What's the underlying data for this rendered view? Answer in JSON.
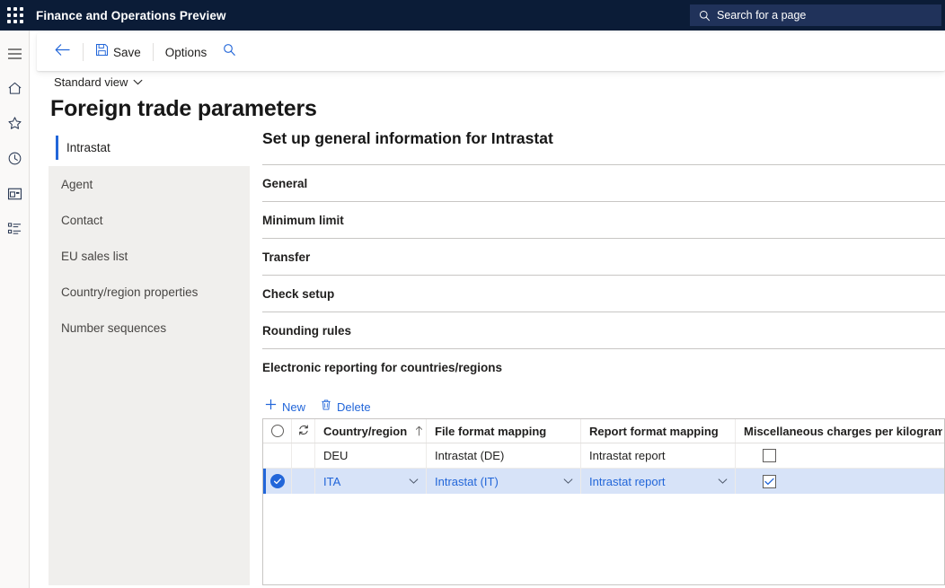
{
  "topbar": {
    "waffle_icon": "waffle-grid-icon",
    "app_title": "Finance and Operations Preview",
    "search": {
      "icon": "search-icon",
      "placeholder": "Search for a page",
      "value": ""
    },
    "background_color": "#0B1C37",
    "search_background_color": "#20325A"
  },
  "rail": {
    "items": [
      {
        "icon": "hamburger-menu-icon",
        "name": "menu"
      },
      {
        "icon": "home-icon",
        "name": "home"
      },
      {
        "icon": "star-icon",
        "name": "favorites"
      },
      {
        "icon": "clock-icon",
        "name": "recent"
      },
      {
        "icon": "workspace-icon",
        "name": "workspaces"
      },
      {
        "icon": "list-icon",
        "name": "modules"
      }
    ]
  },
  "command_bar": {
    "back_icon": "back-arrow-icon",
    "save_icon": "save-disk-icon",
    "save_label": "Save",
    "options_label": "Options",
    "search_icon": "search-icon",
    "accent_color": "#2266D9"
  },
  "page_header": {
    "view_label": "Standard view",
    "view_chevron_icon": "chevron-down-icon",
    "title": "Foreign trade parameters"
  },
  "tab_panel": {
    "items": [
      {
        "label": "Intrastat",
        "selected": true
      },
      {
        "label": "Agent",
        "selected": false
      },
      {
        "label": "Contact",
        "selected": false
      },
      {
        "label": "EU sales list",
        "selected": false
      },
      {
        "label": "Country/region properties",
        "selected": false
      },
      {
        "label": "Number sequences",
        "selected": false
      }
    ],
    "background_color": "#F0EFED",
    "selected_indicator_color": "#2266D9"
  },
  "main": {
    "section_title": "Set up general information for Intrastat",
    "fast_tabs": [
      {
        "label": "General"
      },
      {
        "label": "Minimum limit"
      },
      {
        "label": "Transfer"
      },
      {
        "label": "Check setup"
      },
      {
        "label": "Rounding rules"
      },
      {
        "label": "Electronic reporting for countries/regions"
      }
    ]
  },
  "grid_toolbar": {
    "new_icon": "plus-icon",
    "new_label": "New",
    "delete_icon": "trash-icon",
    "delete_label": "Delete"
  },
  "grid": {
    "select_all_icon": "select-all-circle-icon",
    "refresh_icon": "refresh-icon",
    "columns": [
      {
        "label": "Country/region",
        "sort_icon": "sort-ascending-arrow-icon"
      },
      {
        "label": "File format mapping"
      },
      {
        "label": "Report format mapping"
      },
      {
        "label": "Miscellaneous charges per kilogram"
      }
    ],
    "rows": [
      {
        "selected": false,
        "country_region": "DEU",
        "file_format_mapping": "Intrastat (DE)",
        "report_format_mapping": "Intrastat report",
        "misc_charges_per_kilogram": false
      },
      {
        "selected": true,
        "selected_icon": "check-circle-icon",
        "country_region": "ITA",
        "file_format_mapping": "Intrastat (IT)",
        "report_format_mapping": "Intrastat report",
        "misc_charges_per_kilogram": true,
        "chevron_icon": "chevron-down-icon"
      }
    ],
    "selected_row_color": "#D7E3F8"
  }
}
